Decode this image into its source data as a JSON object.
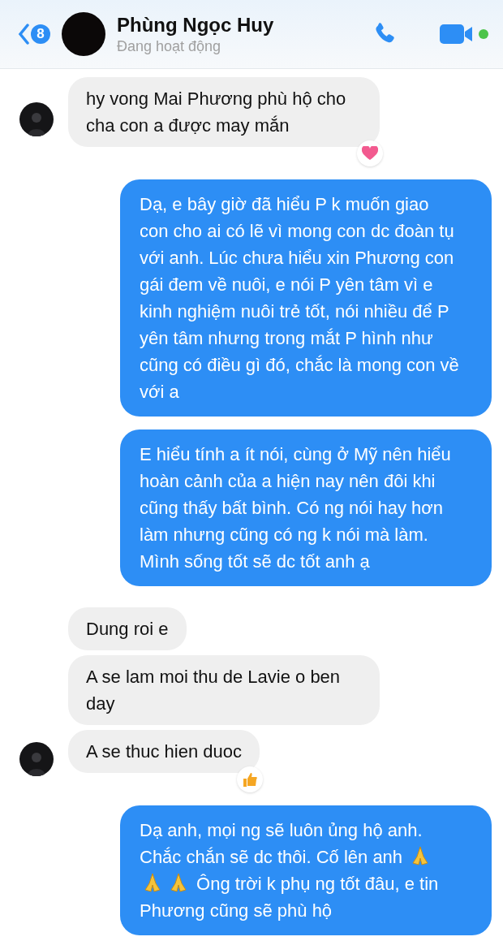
{
  "header": {
    "unread_count": "8",
    "name": "Phùng Ngọc Huy",
    "status": "Đang hoạt động",
    "online": true
  },
  "messages": [
    {
      "outgoing": false,
      "parts": [
        {
          "kind": "text",
          "text": "hy vong Mai Phương phù hộ cho cha con a được may mắn"
        }
      ],
      "avatar": true,
      "reaction": {
        "kind": "heart"
      }
    },
    {
      "outgoing": true,
      "parts": [
        {
          "kind": "text",
          "text": "Dạ, e bây giờ đã hiểu P k muốn giao con cho ai có lẽ vì mong con dc đoàn tụ với anh. Lúc chưa hiểu xin Phương con gái đem về nuôi, e nói P yên tâm vì e kinh nghiệm nuôi trẻ tốt, nói nhiều để P yên tâm nhưng trong mắt P hình như cũng có điều gì đó, chắc là mong con về với a"
        }
      ],
      "avatar": false
    },
    {
      "outgoing": true,
      "parts": [
        {
          "kind": "text",
          "text": "E hiểu tính a ít nói, cùng ở Mỹ nên hiểu hoàn cảnh của a hiện nay nên đôi khi cũng thấy bất bình. Có ng nói hay hơn làm nhưng cũng có ng k nói mà làm. Mình sống tốt sẽ dc tốt anh ạ"
        }
      ],
      "avatar": false
    },
    {
      "outgoing": false,
      "parts": [
        {
          "kind": "text",
          "text": "Dung roi e"
        }
      ],
      "avatar": false
    },
    {
      "outgoing": false,
      "parts": [
        {
          "kind": "text",
          "text": "A se lam moi thu de Lavie o ben day"
        }
      ],
      "avatar": false
    },
    {
      "outgoing": false,
      "parts": [
        {
          "kind": "text",
          "text": "A se thuc hien duoc"
        }
      ],
      "avatar": true,
      "reaction": {
        "kind": "like"
      }
    },
    {
      "outgoing": true,
      "parts": [
        {
          "kind": "text",
          "text": "Dạ anh, mọi ng sẽ luôn ủng hộ anh. Chắc chắn sẽ dc thôi. Cố lên anh "
        },
        {
          "kind": "pray"
        },
        {
          "kind": "pray"
        },
        {
          "kind": "pray"
        },
        {
          "kind": "text",
          "text": " Ông trời k phụ ng tốt đâu, e tin Phương cũng sẽ phù hộ"
        }
      ],
      "avatar": false
    }
  ]
}
